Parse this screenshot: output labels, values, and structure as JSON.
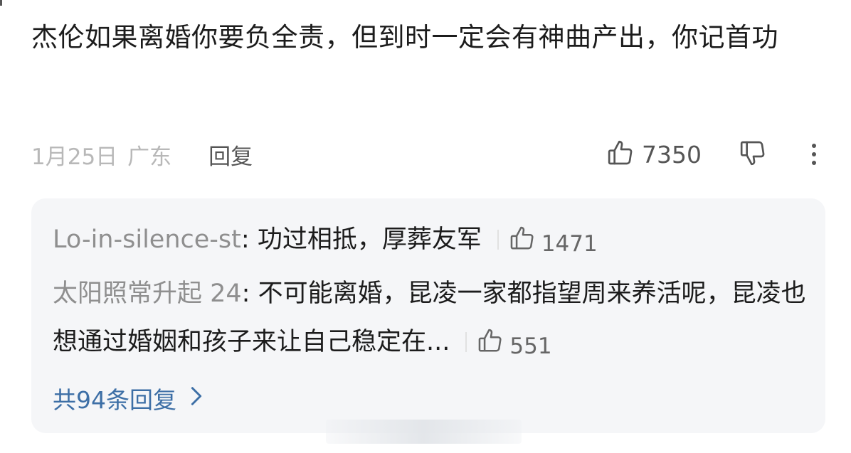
{
  "comment": {
    "text": "杰伦如果离婚你要负全责，但到时一定会有神曲产出，你记首功",
    "date": "1月25日",
    "location": "广东",
    "reply_label": "回复",
    "like_count": "7350"
  },
  "replies": [
    {
      "user": "Lo-in-silence-st",
      "text": "功过相抵，厚葬友军",
      "like_count": "1471"
    },
    {
      "user": "太阳照常升起 24",
      "text": "不可能离婚，昆凌一家都指望周来养活呢，昆凌也想通过婚姻和孩子来让自己稳定在...",
      "like_count": "551"
    }
  ],
  "more_replies": {
    "label": "共94条回复"
  },
  "icons": {
    "like": "thumbs-up-icon",
    "dislike": "thumbs-down-icon",
    "more": "more-vertical-icon",
    "chevron": "chevron-right-icon"
  },
  "colors": {
    "link": "#3d6fa6",
    "muted": "#b8b8b8",
    "reply_bg": "#f5f6f8"
  }
}
